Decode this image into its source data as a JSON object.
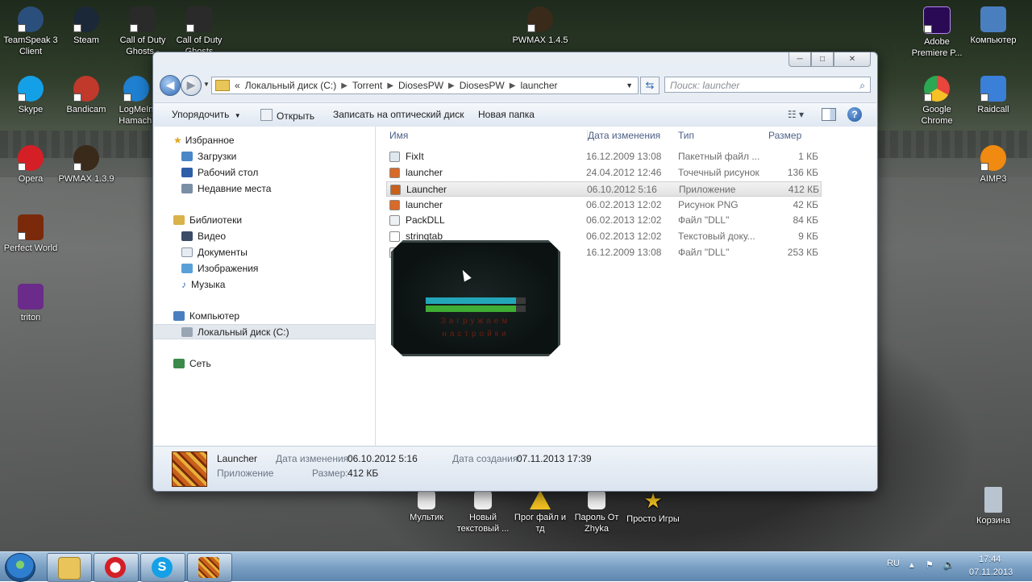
{
  "desktop": {
    "left_icons": [
      {
        "label": "TeamSpeak 3 Client",
        "icon": "teamspeak-icon",
        "color": "#2b4f7c"
      },
      {
        "label": "Steam",
        "icon": "steam-icon",
        "color": "#1b2838"
      },
      {
        "label": "Call of Duty Ghosts -",
        "icon": "call-of-duty-icon",
        "color": "#2a2a2a"
      },
      {
        "label": "Call of Duty Ghosts",
        "icon": "call-of-duty-icon",
        "color": "#2a2a2a"
      },
      {
        "label": "Skype",
        "icon": "skype-icon",
        "color": "#14a0e6"
      },
      {
        "label": "Bandicam",
        "icon": "bandicam-icon",
        "color": "#c0392b"
      },
      {
        "label": "LogMeIn Hamachi",
        "icon": "hamachi-icon",
        "color": "#1f7fd0"
      },
      {
        "label": "Opera",
        "icon": "opera-icon",
        "color": "#d41f26"
      },
      {
        "label": "PWMAX 1.3.9",
        "icon": "pwmax-icon",
        "color": "#3a2a1a"
      },
      {
        "label": "Perfect World",
        "icon": "perfect-world-icon",
        "color": "#7a2a0a"
      },
      {
        "label": "triton",
        "icon": "winrar-icon",
        "color": "#6a2b8a"
      }
    ],
    "top_center_icon": {
      "label": "PWMAX 1.4.5",
      "icon": "pwmax-icon",
      "color": "#3a2a1a"
    },
    "right_icons": [
      {
        "label": "Adobe Premiere P...",
        "icon": "premiere-icon",
        "color": "#2a0a55"
      },
      {
        "label": "Компьютер",
        "icon": "computer-icon",
        "color": "#4a7fbf"
      },
      {
        "label": "Google Chrome",
        "icon": "chrome-icon",
        "color": "#e8453c"
      },
      {
        "label": "Raidcall",
        "icon": "raidcall-icon",
        "color": "#3a7fd8"
      },
      {
        "label": "AIMP3",
        "icon": "aimp-icon",
        "color": "#f08a10"
      },
      {
        "label": "Корзина",
        "icon": "recycle-bin-icon",
        "color": "#b8c4d0"
      }
    ],
    "bottom_icons": [
      {
        "label": "Мультик",
        "icon": "text-file-icon",
        "color": "#f2f2f2"
      },
      {
        "label": "Новый текстовый ...",
        "icon": "text-file-icon",
        "color": "#f2f2f2"
      },
      {
        "label": "Прог файл и тд",
        "icon": "warning-icon",
        "color": "#f0c020"
      },
      {
        "label": "Пароль От Zhyka",
        "icon": "text-file-icon",
        "color": "#f2f2f2"
      },
      {
        "label": "Просто Игры",
        "icon": "star-icon",
        "color": "#f0c020"
      }
    ]
  },
  "explorer": {
    "window_buttons": {
      "minimize": "─",
      "maximize": "□",
      "close": "✕"
    },
    "address": {
      "overflow": "«",
      "crumbs": [
        "Локальный диск (C:)",
        "Torrent",
        "DiosesPW",
        "DiosesPW",
        "launcher"
      ],
      "separator": "▶"
    },
    "search_placeholder": "Поиск: launcher",
    "toolbar": {
      "organize": "Упорядочить",
      "open": "Открыть",
      "burn": "Записать на оптический диск",
      "new_folder": "Новая папка"
    },
    "nav": {
      "favorites": "Избранное",
      "downloads": "Загрузки",
      "desktop": "Рабочий стол",
      "recent": "Недавние места",
      "libraries": "Библиотеки",
      "video": "Видео",
      "documents": "Документы",
      "images": "Изображения",
      "music": "Музыка",
      "computer": "Компьютер",
      "local_disk": "Локальный диск (C:)",
      "network": "Сеть"
    },
    "columns": {
      "name": "Имя",
      "date": "Дата изменения",
      "type": "Тип",
      "size": "Размер"
    },
    "files": [
      {
        "name": "FixIt",
        "date": "16.12.2009 13:08",
        "type": "Пакетный файл ...",
        "size": "1 КБ",
        "icon": "batch-file-icon",
        "color": "#dfe8f0"
      },
      {
        "name": "launcher",
        "date": "24.04.2012 12:46",
        "type": "Точечный рисунок",
        "size": "136 КБ",
        "icon": "bitmap-icon",
        "color": "#d86a2a"
      },
      {
        "name": "Launcher",
        "date": "06.10.2012 5:16",
        "type": "Приложение",
        "size": "412 КБ",
        "icon": "launcher-app-icon",
        "color": "#c9601a"
      },
      {
        "name": "launcher",
        "date": "06.02.2013 12:02",
        "type": "Рисунок PNG",
        "size": "42 КБ",
        "icon": "png-icon",
        "color": "#d86a2a"
      },
      {
        "name": "PackDLL",
        "date": "06.02.2013 12:02",
        "type": "Файл \"DLL\"",
        "size": "84 КБ",
        "icon": "dll-icon",
        "color": "#eef1f4"
      },
      {
        "name": "stringtab",
        "date": "06.02.2013 12:02",
        "type": "Текстовый доку...",
        "size": "9 КБ",
        "icon": "text-file-icon",
        "color": "#ffffff"
      },
      {
        "name": "",
        "date": "16.12.2009 13:08",
        "type": "Файл \"DLL\"",
        "size": "253 КБ",
        "icon": "dll-icon",
        "color": "#eef1f4"
      }
    ],
    "details": {
      "name": "Launcher",
      "type": "Приложение",
      "modified_label": "Дата изменения:",
      "modified_value": "06.10.2012 5:16",
      "size_label": "Размер:",
      "size_value": "412 КБ",
      "created_label": "Дата создания:",
      "created_value": "07.11.2013 17:39"
    }
  },
  "splash": {
    "line1": "Загружаем",
    "line2": "настройки",
    "bar1_color": "#23a6b8",
    "bar2_color": "#3fae34",
    "progress": 0.9
  },
  "taskbar": {
    "items": [
      {
        "name": "explorer",
        "icon": "explorer-folder-icon",
        "color": "#e8c45a"
      },
      {
        "name": "opera",
        "icon": "opera-icon",
        "color": "#d41f26"
      },
      {
        "name": "skype",
        "icon": "skype-icon",
        "color": "#14a0e6"
      },
      {
        "name": "launcher",
        "icon": "launcher-app-icon",
        "color": "#c9601a"
      }
    ],
    "lang": "RU",
    "time": "17:44",
    "date": "07.11.2013"
  }
}
